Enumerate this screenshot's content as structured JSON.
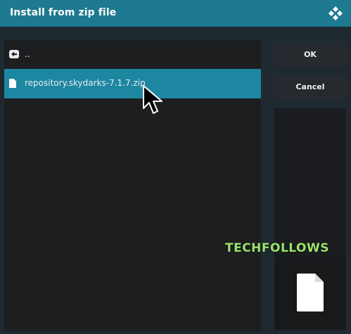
{
  "dialog": {
    "title": "Install from zip file",
    "logo_icon": "kodi-logo-icon"
  },
  "file_list": {
    "items": [
      {
        "label": "..",
        "icon": "back-arrow-icon"
      },
      {
        "label": "repository.skydarks-7.1.7.zip",
        "icon": "file-icon",
        "selected": true
      }
    ]
  },
  "buttons": {
    "ok_label": "OK",
    "cancel_label": "Cancel"
  },
  "preview": {
    "icon": "file-large-icon"
  },
  "watermark": {
    "text": "TECHFOLLOWS",
    "color": "#9be36c"
  },
  "colors": {
    "titlebar": "#1d7a90",
    "selection": "#1d86a1",
    "background": "#1f2a30",
    "list_background": "#1c1e20"
  }
}
